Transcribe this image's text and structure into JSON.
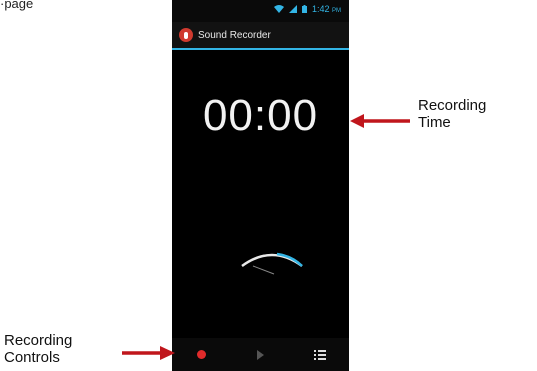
{
  "page_fragment_text": "·page",
  "status_bar": {
    "time": "1:42",
    "ampm": "PM",
    "icons": [
      "wifi-icon",
      "signal-icon",
      "battery-icon"
    ]
  },
  "app": {
    "title": "Sound Recorder",
    "icon": "microphone-icon"
  },
  "timer": {
    "value": "00:00"
  },
  "controls": {
    "icons": [
      "record-icon",
      "play-icon",
      "list-icon"
    ]
  },
  "annotations": {
    "recording_time": {
      "line1": "Recording",
      "line2": "Time"
    },
    "recording_controls": {
      "line1": "Recording",
      "line2": "Controls"
    }
  },
  "colors": {
    "accent": "#33b5e5",
    "record": "#e02b2b",
    "arrow": "#c0161c",
    "background": "#000000"
  }
}
